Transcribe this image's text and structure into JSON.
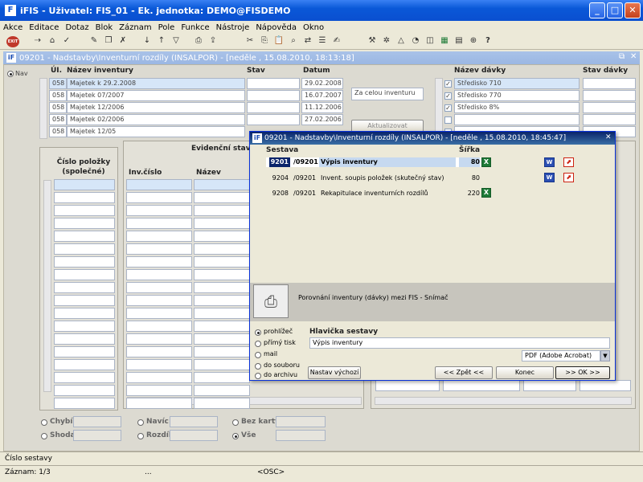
{
  "window": {
    "title": "iFIS - Uživatel: FIS_01 - Ek. jednotka: DEMO@FISDEMO",
    "logo": "F",
    "min": "_",
    "max": "□",
    "close": "✕"
  },
  "menu": [
    "Akce",
    "Editace",
    "Dotaz",
    "Blok",
    "Záznam",
    "Pole",
    "Funkce",
    "Nástroje",
    "Nápověda",
    "Okno"
  ],
  "toolbar": {
    "exit_label": "EXIT"
  },
  "app": {
    "title": "09201 - Nadstavby\\Inventurní rozdíly (INSALPOR) - [neděle , 15.08.2010, 18:13:18]",
    "restore": "⧉",
    "close": "✕",
    "logo": "iF"
  },
  "nav": {
    "label": "Nav"
  },
  "inventory": {
    "headers": {
      "ul": "ÚI.",
      "name": "Název inventury",
      "stav": "Stav",
      "datum": "Datum"
    },
    "rows": [
      {
        "ul": "058",
        "name": "Majetek k 29.2.2008",
        "stav": "",
        "datum": "29.02.2008"
      },
      {
        "ul": "058",
        "name": "Majetek 07/2007",
        "stav": "",
        "datum": "16.07.2007"
      },
      {
        "ul": "058",
        "name": "Majetek 12/2006",
        "stav": "",
        "datum": "11.12.2006"
      },
      {
        "ul": "058",
        "name": "Majetek 02/2006",
        "stav": "",
        "datum": "27.02.2006"
      },
      {
        "ul": "058",
        "name": "Majetek 12/05",
        "stav": "",
        "datum": ""
      }
    ],
    "scope_select": "Za celou inventuru",
    "refresh_button": "Aktualizovat"
  },
  "batches": {
    "headers": {
      "name": "Název dávky",
      "stav": "Stav dávky"
    },
    "rows": [
      {
        "checked": true,
        "name": "Středisko 710"
      },
      {
        "checked": true,
        "name": "Středisko 770"
      },
      {
        "checked": true,
        "name": "Středisko 8%"
      },
      {
        "checked": false,
        "name": ""
      },
      {
        "checked": false,
        "name": ""
      }
    ]
  },
  "lower": {
    "item_no_header": "Číslo položky (společné)",
    "evid_header": "Evidenční stav",
    "inv_cislo": "Inv.číslo",
    "nazev": "Název"
  },
  "filters": [
    {
      "label": "Chybí",
      "on": false
    },
    {
      "label": "Shoda",
      "on": false
    },
    {
      "label": "Navíc",
      "on": false
    },
    {
      "label": "Rozdíl",
      "on": false
    },
    {
      "label": "Bez karty",
      "on": false
    },
    {
      "label": "Vše",
      "on": true
    }
  ],
  "dialog": {
    "title": "09201 - Nadstavby\\Inventurní rozdíly (INSALPOR) - [neděle , 15.08.2010, 18:45:47]",
    "close": "✕",
    "col_sestava": "Sestava",
    "col_sirka": "Šířka",
    "reports": [
      {
        "code": "9201",
        "sub": "/09201",
        "name": "Výpis inventury",
        "width": "80",
        "selected": true,
        "xls": true,
        "word": true,
        "pdf": true
      },
      {
        "code": "9204",
        "sub": "/09201",
        "name": "Invent. soupis položek (skutečný stav)",
        "width": "80",
        "selected": false,
        "xls": true,
        "word": true,
        "pdf": true
      },
      {
        "code": "9208",
        "sub": "/09201",
        "name": "Rekapitulace inventurních rozdílů",
        "width": "220",
        "selected": false,
        "xls": true,
        "word": false,
        "pdf": false
      }
    ],
    "description": "Porovnání inventury (dávky) mezi FIS - Snímač",
    "outputs": [
      {
        "label": "prohlížeč",
        "on": true
      },
      {
        "label": "přímý tisk",
        "on": false
      },
      {
        "label": "mail",
        "on": false
      },
      {
        "label": "do souboru",
        "on": false
      },
      {
        "label": "do archivu",
        "on": false
      }
    ],
    "header_label": "Hlavička sestavy",
    "header_value": "Výpis inventury",
    "format_select": "PDF (Adobe Acrobat)",
    "btn_default": "Nastav výchozí",
    "btn_back": "<< Zpět <<",
    "btn_end": "Konec",
    "btn_ok": ">> OK >>"
  },
  "status": {
    "line1": "Číslo sestavy",
    "record": "Záznam: 1/3",
    "dots": "...",
    "osc": "<OSC>"
  }
}
